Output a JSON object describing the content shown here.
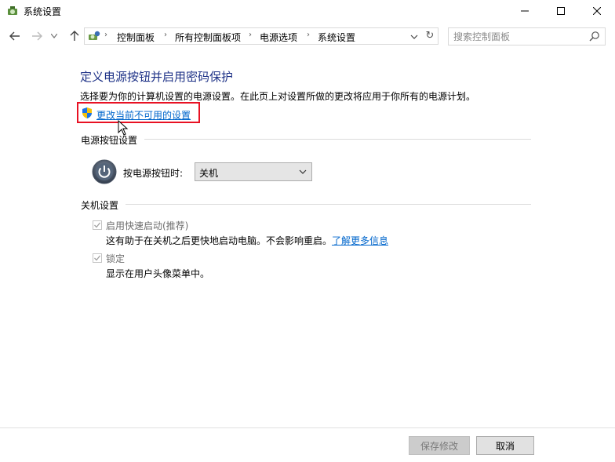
{
  "window": {
    "title": "系统设置"
  },
  "address": {
    "crumbs": [
      "控制面板",
      "所有控制面板项",
      "电源选项",
      "系统设置"
    ]
  },
  "search": {
    "placeholder": "搜索控制面板"
  },
  "main": {
    "heading": "定义电源按钮并启用密码保护",
    "description": "选择要为你的计算机设置的电源设置。在此页上对设置所做的更改将应用于你所有的电源计划。",
    "change_link": "更改当前不可用的设置"
  },
  "power_section": {
    "title": "电源按钮设置",
    "label": "按电源按钮时:",
    "selected": "关机"
  },
  "shutdown_section": {
    "title": "关机设置",
    "fast_startup": {
      "label": "启用快速启动(推荐)",
      "checked": true,
      "desc": "这有助于在关机之后更快地启动电脑。不会影响重启。",
      "more_link": "了解更多信息"
    },
    "lock": {
      "label": "锁定",
      "checked": true,
      "desc": "显示在用户头像菜单中。"
    }
  },
  "footer": {
    "save": "保存修改",
    "cancel": "取消"
  },
  "colors": {
    "heading": "#1e3287",
    "link": "#0066cc",
    "highlight": "#e81123"
  }
}
